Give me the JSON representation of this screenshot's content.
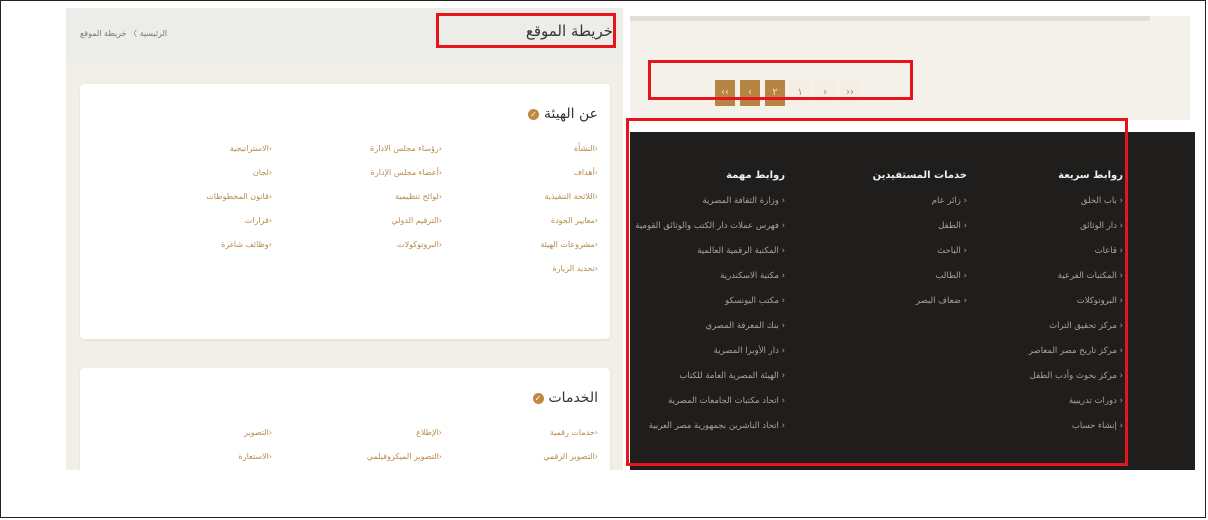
{
  "header": {
    "page_title": "خريطة الموقع",
    "breadcrumb": "الرئيسية 〉 خريطة الموقع"
  },
  "about": {
    "title": "عن الهيئة",
    "col1": [
      "النشأة",
      "أهداف",
      "اللائحة التنفيذية",
      "معايير الجودة",
      "مشروعات الهيئة",
      "تحديد الزيارة"
    ],
    "col2": [
      "رؤساء مجلس الادارة",
      "أعضاء مجلس الإدارة",
      "لوائح تنظيمية",
      "الترقيم الدولي",
      "البروتوكولات"
    ],
    "col3": [
      "الاستراتيجية",
      "لجان",
      "قانون المخطوطات",
      "قرارات",
      "وظائف شاغرة"
    ]
  },
  "services": {
    "title": "الخدمات",
    "col1": [
      "خدمات رقمية",
      "التصوير الرقمي"
    ],
    "col2": [
      "الإطلاع",
      "التصوير الميكروفيلمي"
    ],
    "col3": [
      "التصوير",
      "الاستعارة"
    ]
  },
  "pagination": [
    "‹‹",
    "‹",
    "٢",
    "١",
    "›",
    "››"
  ],
  "footer": {
    "quick_links": {
      "title": "روابط سريعة",
      "items": [
        "باب الخلق",
        "دار الوثائق",
        "قاعات",
        "المكتبات الفرعية",
        "البروتوكلات",
        "مركز تحقيق التراث",
        "مركز تاريخ مصر المعاصر",
        "مركز بحوث وأدب الطفل",
        "دورات تدريبية",
        "إنشاء حساب"
      ]
    },
    "beneficiaries": {
      "title": "خدمات المستفيدين",
      "items": [
        "زائر عام",
        "الطفل",
        "الباحث",
        "الطالب",
        "ضعاف البصر"
      ]
    },
    "important_links": {
      "title": "روابط مهمة",
      "items": [
        "وزارة الثقافة المصرية",
        "فهرس عملات دار الكتب والوثائق القومية",
        "المكتبة الرقمية العالمية",
        "مكتبة الاسكندرية",
        "مكتب اليونسكو",
        "بنك المعرفة المصري",
        "دار الأوبرا المصرية",
        "الهيئة المصرية العامة للكتاب",
        "اتحاد مكتبات الجامعات المصرية",
        "اتحاد الناشرين بجمهورية مصر العربية"
      ]
    }
  },
  "colors": {
    "accent": "#c2873e",
    "highlight": "#e8141c",
    "footer_bg": "#1f1e1c"
  }
}
